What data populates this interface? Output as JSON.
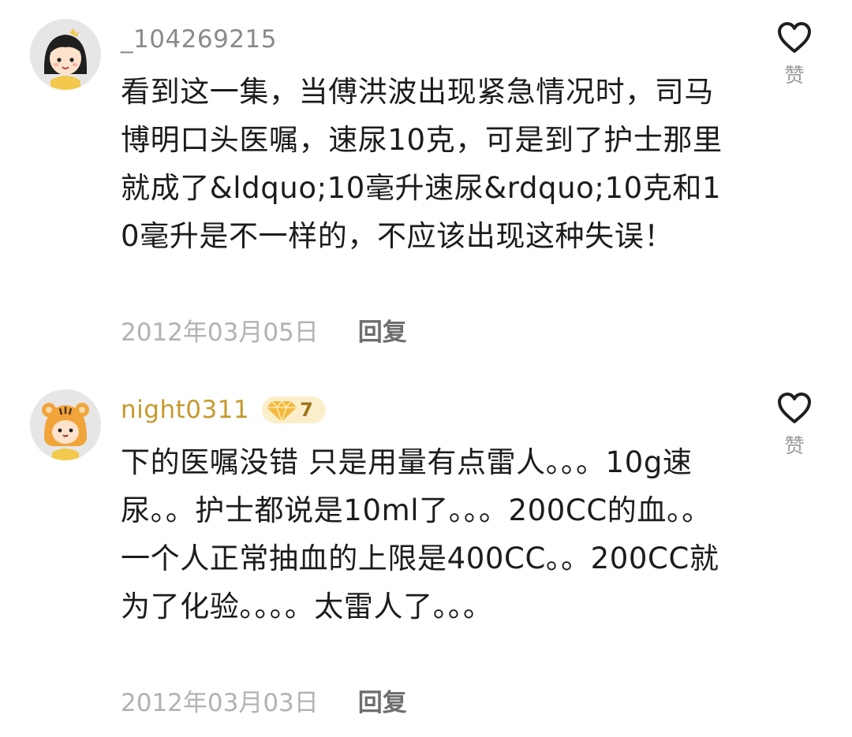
{
  "comments": [
    {
      "username": "_104269215",
      "avatar_icon": "girl-avatar-icon",
      "text": "看到这一集，当傅洪波出现紧急情况时，司马博明口头医嘱，速尿10克，可是到了护士那里就成了&ldquo;10毫升速尿&rdquo;10克和10毫升是不一样的，不应该出现这种失误！",
      "date": "2012年03月05日",
      "reply_label": "回复",
      "like_label": "赞"
    },
    {
      "username": "night0311",
      "avatar_icon": "tiger-avatar-icon",
      "badge_icon": "diamond-icon",
      "level": "7",
      "text": "下的医嘱没错  只是用量有点雷人。。。10g速尿。。护士都说是10ml了。。。200CC的血。。一个人正常抽血的上限是400CC。。200CC就为了化验。。。。太雷人了。。。",
      "date": "2012年03月03日",
      "reply_label": "回复",
      "like_label": "赞"
    }
  ],
  "colors": {
    "username": "#8a8a8a",
    "username_vip": "#c49a2c",
    "body_text": "#1c1c1c",
    "date": "#b2b2b2",
    "reply": "#6e6e6e",
    "badge_bg": "#fbeecb"
  }
}
